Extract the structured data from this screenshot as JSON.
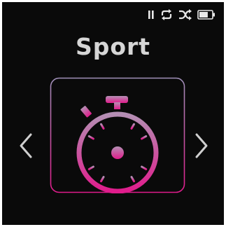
{
  "status": {
    "icons": [
      "pause-icon",
      "repeat-icon",
      "shuffle-icon",
      "battery-icon"
    ],
    "battery_level": 0.7
  },
  "menu": {
    "title": "Sport",
    "icon": "stopwatch-icon",
    "prev": "chevron-left-icon",
    "next": "chevron-right-icon"
  },
  "colors": {
    "background": "#0a0a0a",
    "title_text": "#d6d6d6",
    "icon_gradient_top": "#b48fb4",
    "icon_gradient_bottom": "#e01c8c",
    "arrows": "#cfcfcf",
    "status_icons": "#e8e8e8"
  }
}
